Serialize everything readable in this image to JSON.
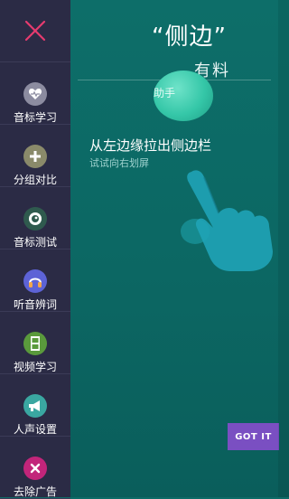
{
  "main": {
    "big_quote": "“侧边”",
    "sub_title": "有料",
    "bubble_text": "助手",
    "hint_title": "从左边缘拉出侧边栏",
    "hint_sub": "试试向右划屏",
    "got_it": "GOT IT"
  },
  "sidebar": {
    "items": [
      {
        "label": "音标学习",
        "icon": "heart-icon",
        "color": "#8c8ca0"
      },
      {
        "label": "分组对比",
        "icon": "plus-icon",
        "color": "#8a8a6a"
      },
      {
        "label": "音标测试",
        "icon": "eye-icon",
        "color": "#2f5a4e"
      },
      {
        "label": "听音辨词",
        "icon": "headphones-icon",
        "color": "#5d63d6"
      },
      {
        "label": "视频学习",
        "icon": "film-icon",
        "color": "#5a9a3c"
      },
      {
        "label": "人声设置",
        "icon": "megaphone-icon",
        "color": "#3aa7a1"
      },
      {
        "label": "去除广告",
        "icon": "remove-icon",
        "color": "#c2257a"
      }
    ]
  },
  "colors": {
    "sidebar_bg": "#2b2b45",
    "main_bg": "#0d6e69",
    "close_accent": "#e63b6f",
    "button_bg": "#7a4fc2"
  }
}
